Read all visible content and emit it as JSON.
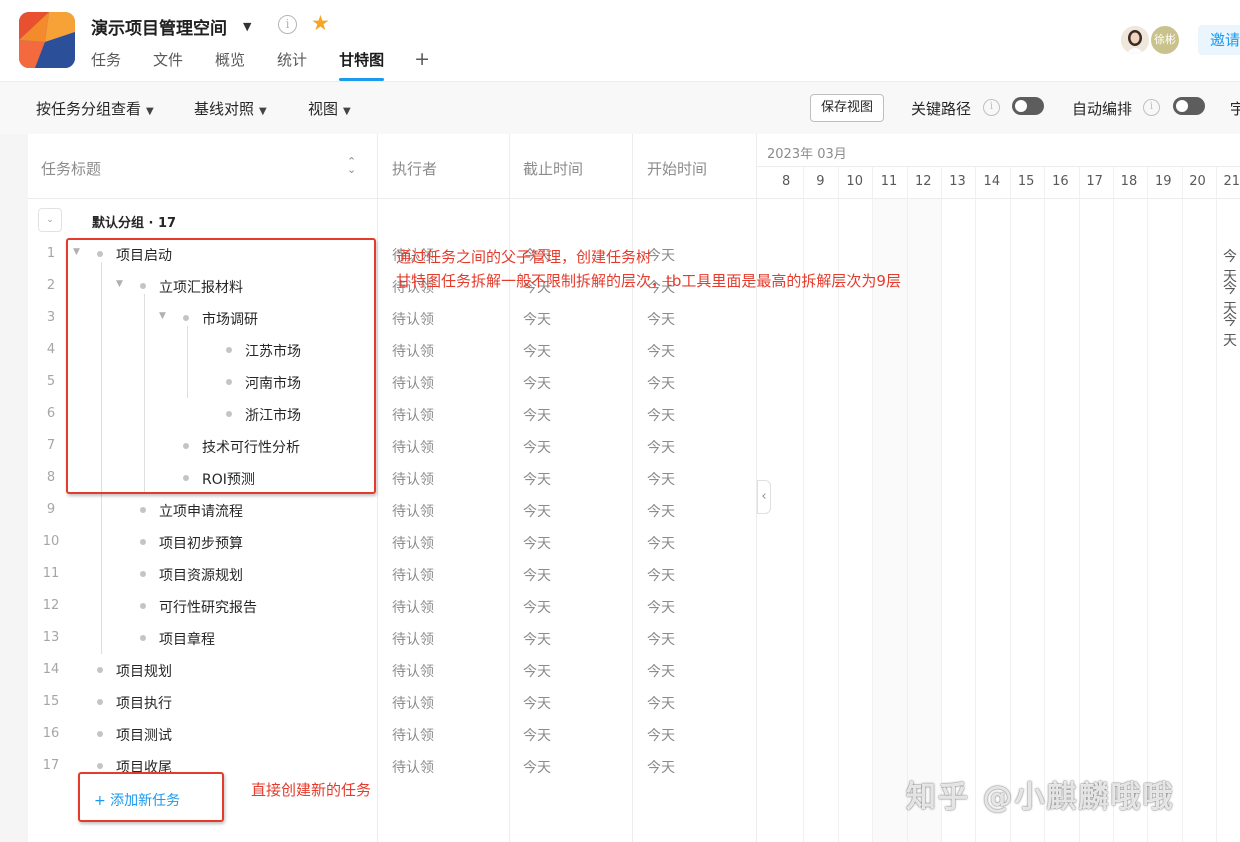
{
  "header": {
    "project_title": "演示项目管理空间",
    "tabs": [
      {
        "label": "任务"
      },
      {
        "label": "文件"
      },
      {
        "label": "概览"
      },
      {
        "label": "统计"
      },
      {
        "label": "甘特图",
        "active": true
      }
    ],
    "add_tab_symbol": "+",
    "avatar2_text": "徐彬",
    "invite_label": "邀请"
  },
  "toolbar": {
    "group_by": "按任务分组查看",
    "baseline": "基线对照",
    "view": "视图",
    "save_view": "保存视图",
    "critical_path": "关键路径",
    "auto_schedule": "自动编排",
    "cut_label": "宇"
  },
  "table": {
    "headers": {
      "title": "任务标题",
      "executor": "执行者",
      "due": "截止时间",
      "start": "开始时间"
    },
    "group": {
      "label": "默认分组 · 17"
    },
    "rows": [
      {
        "num": "1",
        "title": "项目启动",
        "level": 0,
        "expanded": true,
        "executor": "待认领",
        "due": "今天",
        "start": "今天"
      },
      {
        "num": "2",
        "title": "立项汇报材料",
        "level": 1,
        "expanded": true,
        "executor": "待认领",
        "due": "今天",
        "start": "今天"
      },
      {
        "num": "3",
        "title": "市场调研",
        "level": 2,
        "expanded": true,
        "executor": "待认领",
        "due": "今天",
        "start": "今天"
      },
      {
        "num": "4",
        "title": "江苏市场",
        "level": 3,
        "executor": "待认领",
        "due": "今天",
        "start": "今天"
      },
      {
        "num": "5",
        "title": "河南市场",
        "level": 3,
        "executor": "待认领",
        "due": "今天",
        "start": "今天"
      },
      {
        "num": "6",
        "title": "浙江市场",
        "level": 3,
        "executor": "待认领",
        "due": "今天",
        "start": "今天"
      },
      {
        "num": "7",
        "title": "技术可行性分析",
        "level": 2,
        "executor": "待认领",
        "due": "今天",
        "start": "今天"
      },
      {
        "num": "8",
        "title": "ROI预测",
        "level": 2,
        "executor": "待认领",
        "due": "今天",
        "start": "今天"
      },
      {
        "num": "9",
        "title": "立项申请流程",
        "level": 1,
        "executor": "待认领",
        "due": "今天",
        "start": "今天"
      },
      {
        "num": "10",
        "title": "项目初步预算",
        "level": 1,
        "executor": "待认领",
        "due": "今天",
        "start": "今天"
      },
      {
        "num": "11",
        "title": "项目资源规划",
        "level": 1,
        "executor": "待认领",
        "due": "今天",
        "start": "今天"
      },
      {
        "num": "12",
        "title": "可行性研究报告",
        "level": 1,
        "executor": "待认领",
        "due": "今天",
        "start": "今天"
      },
      {
        "num": "13",
        "title": "项目章程",
        "level": 1,
        "executor": "待认领",
        "due": "今天",
        "start": "今天"
      },
      {
        "num": "14",
        "title": "项目规划",
        "level": 0,
        "executor": "待认领",
        "due": "今天",
        "start": "今天"
      },
      {
        "num": "15",
        "title": "项目执行",
        "level": 0,
        "executor": "待认领",
        "due": "今天",
        "start": "今天"
      },
      {
        "num": "16",
        "title": "项目测试",
        "level": 0,
        "executor": "待认领",
        "due": "今天",
        "start": "今天"
      },
      {
        "num": "17",
        "title": "项目收尾",
        "level": 0,
        "executor": "待认领",
        "due": "今天",
        "start": "今天"
      }
    ],
    "add_task": "+ 添加新任务"
  },
  "gantt": {
    "month": "2023年 03月",
    "days": [
      "8",
      "9",
      "10",
      "11",
      "12",
      "13",
      "14",
      "15",
      "16",
      "17",
      "18",
      "19",
      "20",
      "21"
    ],
    "today_label": "今天",
    "collapse_handle": "‹"
  },
  "annotations": {
    "line1": "通过任务之间的父子管理，创建任务树",
    "line2": "甘特图任务拆解一般不限制拆解的层次，tb工具里面是最高的拆解层次为9层",
    "add_note": "直接创建新的任务",
    "color": "#e53b2c"
  },
  "watermark": "知乎 @小麒麟哦哦",
  "colors": {
    "accent": "#1b9aee",
    "star": "#f5a623",
    "annotation": "#e53b2c"
  }
}
